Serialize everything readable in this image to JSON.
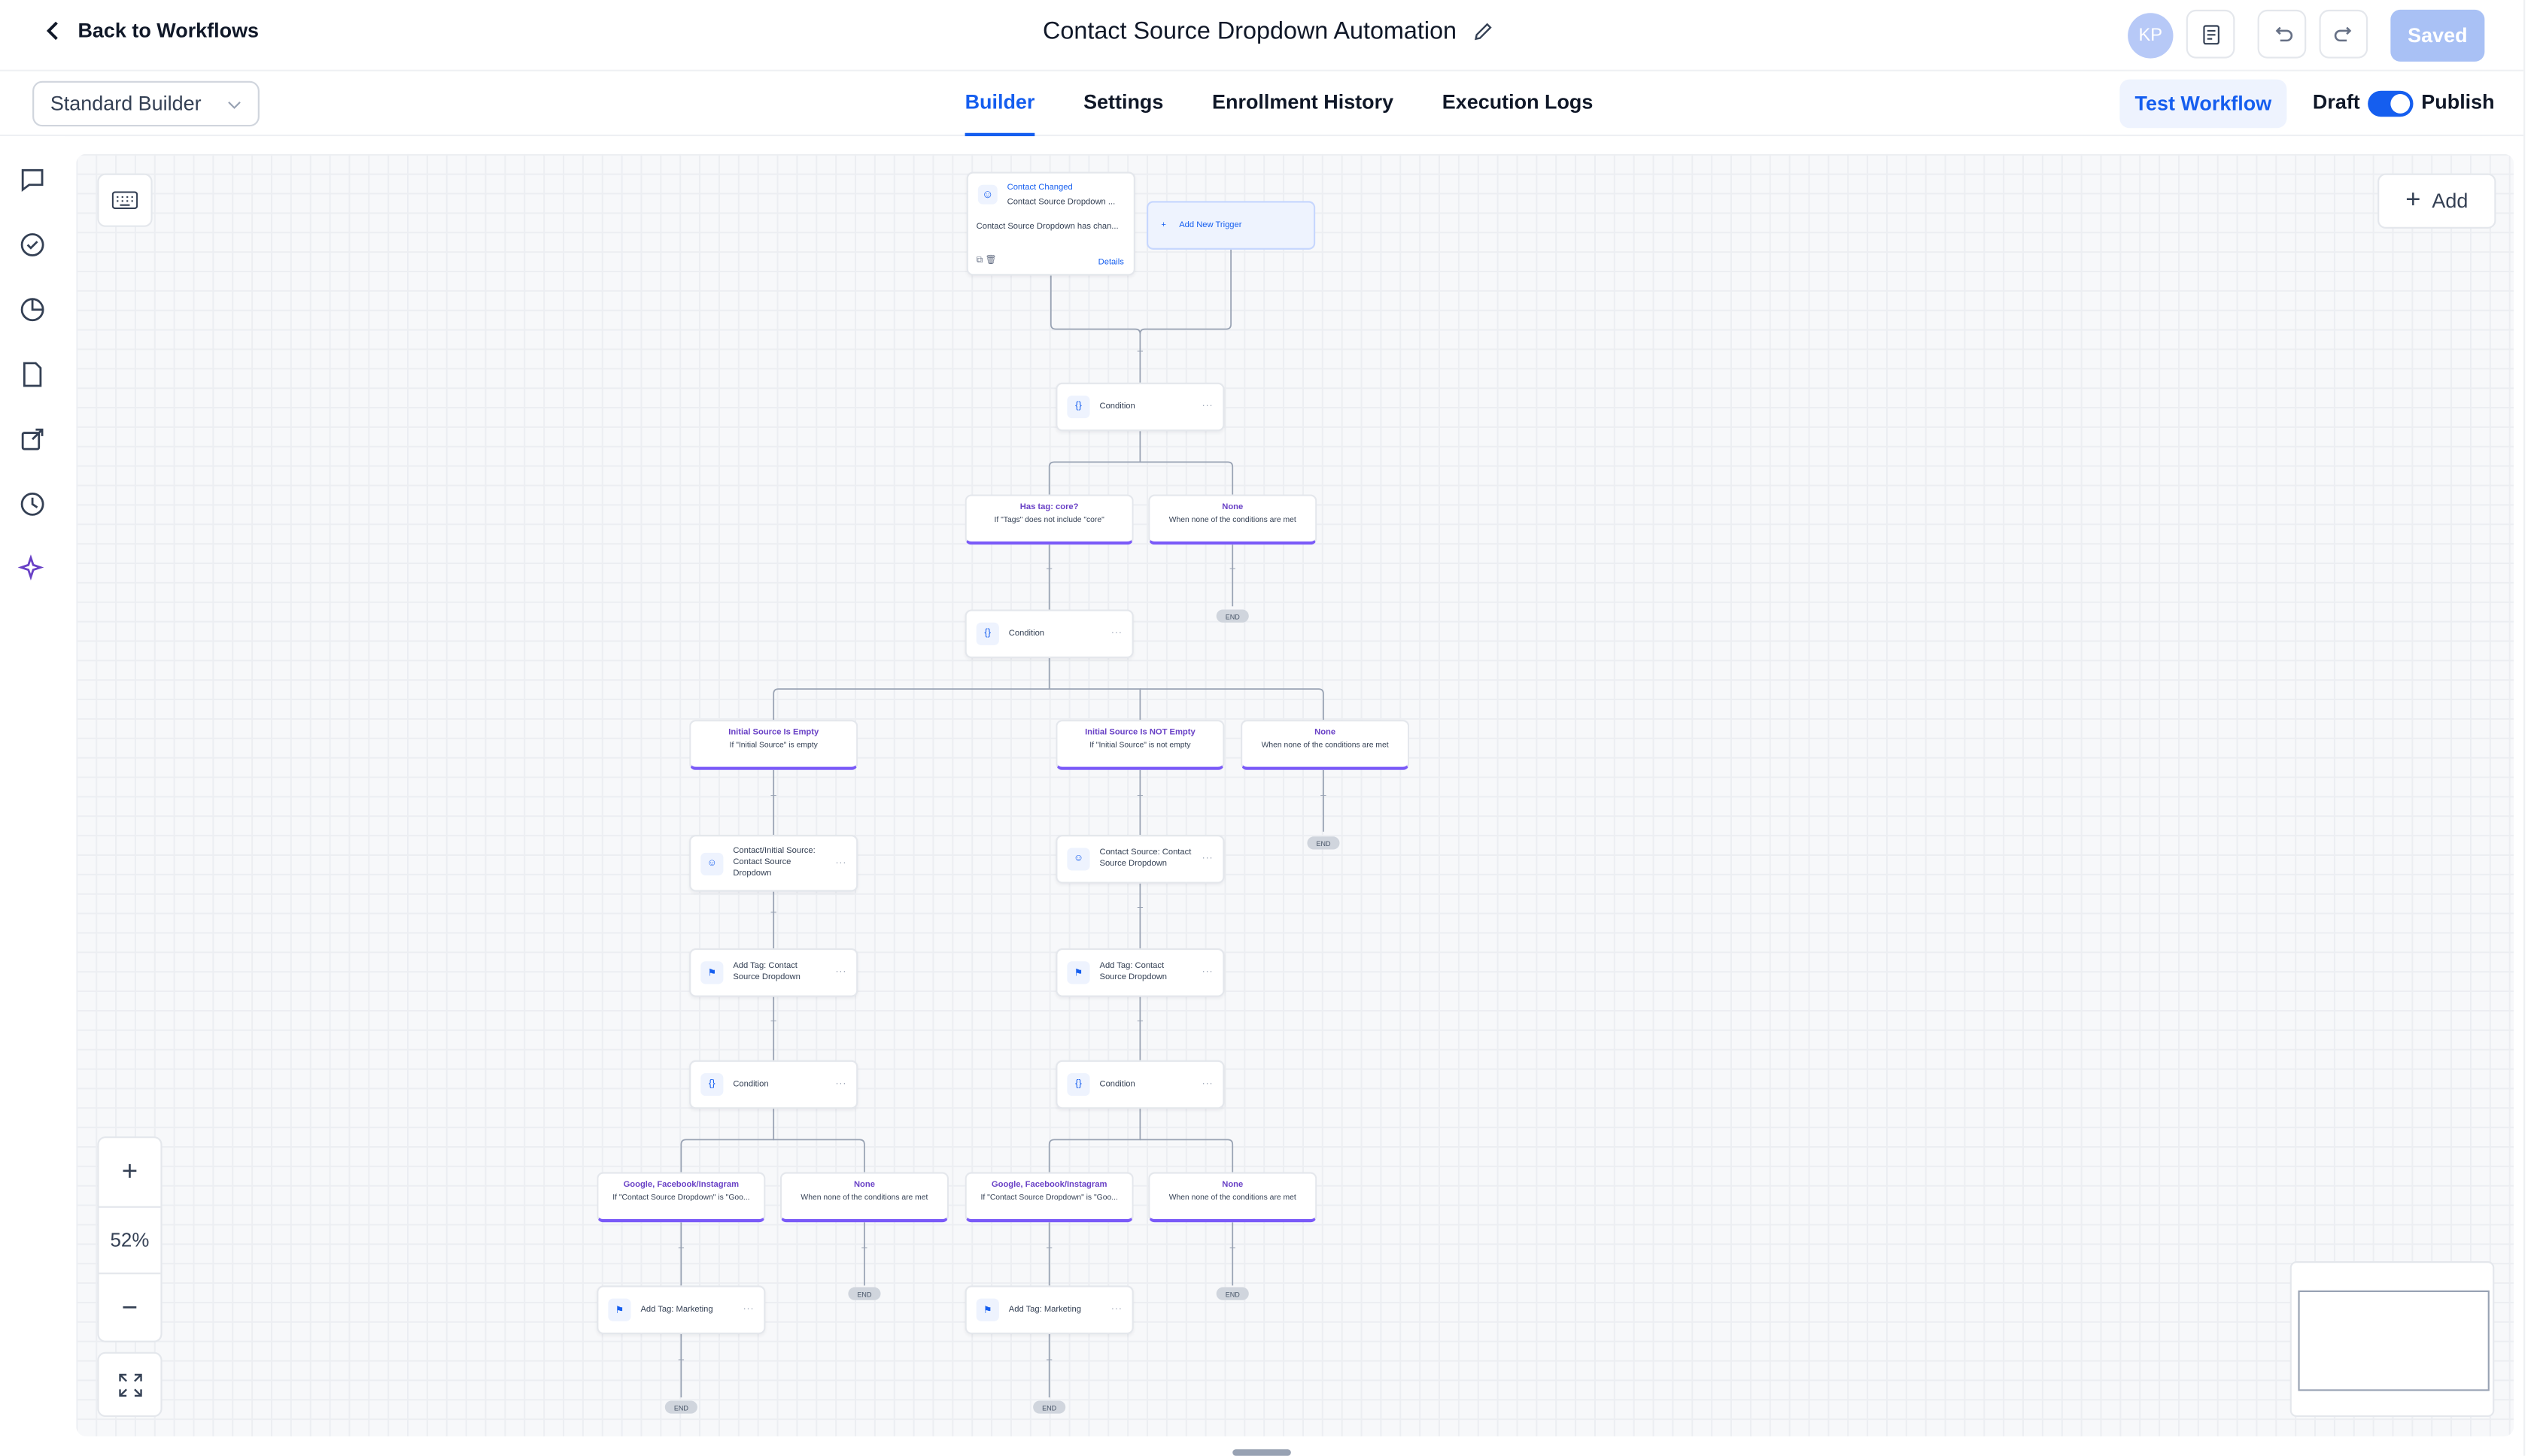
{
  "header": {
    "back_label": "Back to Workflows",
    "title": "Contact Source Dropdown Automation",
    "avatar_initials": "KP",
    "saved_label": "Saved"
  },
  "subbar": {
    "builder_mode": "Standard Builder",
    "tabs": [
      "Builder",
      "Settings",
      "Enrollment History",
      "Execution Logs"
    ],
    "active_tab": "Builder",
    "test_label": "Test Workflow",
    "draft_label": "Draft",
    "publish_label": "Publish"
  },
  "canvas": {
    "add_label": "Add",
    "zoom_level": "52%",
    "trigger": {
      "title": "Contact Changed",
      "subtitle": "Contact Source Dropdown ...",
      "description": "Contact Source Dropdown has chan...",
      "details_label": "Details"
    },
    "add_trigger_label": "Add New Trigger",
    "condition_label": "Condition",
    "end_label": "END",
    "branches": {
      "has_tag": {
        "title": "Has tag: core?",
        "sub": "If \"Tags\" does not include \"core\""
      },
      "none": {
        "title": "None",
        "sub": "When none of the conditions are met"
      },
      "initial_empty": {
        "title": "Initial Source Is Empty",
        "sub": "If \"Initial Source\" is empty"
      },
      "initial_not_empty": {
        "title": "Initial Source Is NOT Empty",
        "sub": "If \"Initial Source\" is not empty"
      },
      "google": {
        "title": "Google, Facebook/Instagram",
        "sub": "If \"Contact Source Dropdown\" is \"Goo..."
      }
    },
    "actions": {
      "contact_initial_source": "Contact/Initial Source: Contact Source Dropdown",
      "contact_source": "Contact Source: Contact Source Dropdown",
      "add_tag_source": "Add Tag: Contact Source Dropdown",
      "add_tag_marketing": "Add Tag: Marketing"
    }
  },
  "colors": {
    "accent": "#155eef",
    "branch_accent": "#7a5af8",
    "saved_bg": "#a9c1f5"
  }
}
